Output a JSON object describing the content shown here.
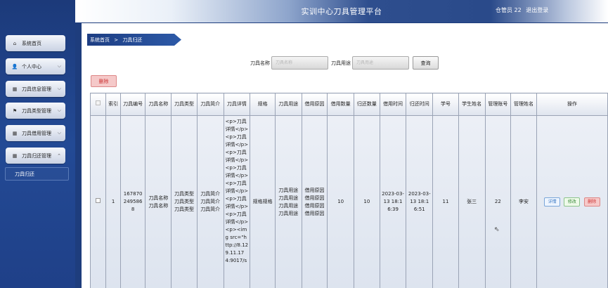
{
  "header": {
    "title": "实训中心刀具管理平台",
    "user_label": "仓管员 22",
    "logout": "退出登录"
  },
  "sidebar": {
    "items": [
      {
        "label": "系统首页",
        "icon": "⌂"
      },
      {
        "label": "个人中心",
        "icon": "👤"
      },
      {
        "label": "刀具信息管理",
        "icon": "▦"
      },
      {
        "label": "刀具类型管理",
        "icon": "⚑"
      },
      {
        "label": "刀具借用管理",
        "icon": "▦"
      },
      {
        "label": "刀具归还管理",
        "icon": "▦"
      }
    ],
    "sub_item": "刀具归还"
  },
  "breadcrumb": {
    "home": "系统首页",
    "sep": ">",
    "current": "刀具归还"
  },
  "search": {
    "name_label": "刀具名称",
    "name_placeholder": "刀具名称",
    "usage_label": "刀具用途",
    "usage_placeholder": "刀具用途",
    "query_button": "查询"
  },
  "delete_button": "删除",
  "table": {
    "headers": [
      "索引",
      "刀具编号",
      "刀具名称",
      "刀具类型",
      "刀具简介",
      "刀具详情",
      "规格",
      "刀具用途",
      "借用原因",
      "借用数量",
      "归还数量",
      "借用时间",
      "归还时间",
      "学号",
      "学生姓名",
      "管理账号",
      "管理姓名",
      "操作"
    ],
    "row": {
      "index": "1",
      "code": "1678702495868",
      "name": "刀具名称刀具名称",
      "type": "刀具类型刀具类型刀具类型",
      "intro": "刀具简介刀具简介刀具简介",
      "detail": "<p>刀具详情</p><p>刀具详情</p><p>刀具详情</p><p>刀具详情</p><p>刀具详情</p><p>刀具详情</p><p>刀具详情</p><p><img src=\"http://8.129.11.174:9017/s",
      "spec": "规格规格",
      "usage": "刀具用途刀具用途刀具用途刀具用途",
      "reason": "借用原因借用原因借用原因借用原因",
      "borrow_qty": "10",
      "return_qty": "10",
      "borrow_time": "2023-03-13 18:16:39",
      "return_time": "2023-03-13 18:16:51",
      "student_no": "11",
      "student_name": "张三",
      "admin_account": "22",
      "admin_name": "李安",
      "actions": {
        "detail": "详情",
        "edit": "修改",
        "delete": "删除"
      }
    }
  }
}
